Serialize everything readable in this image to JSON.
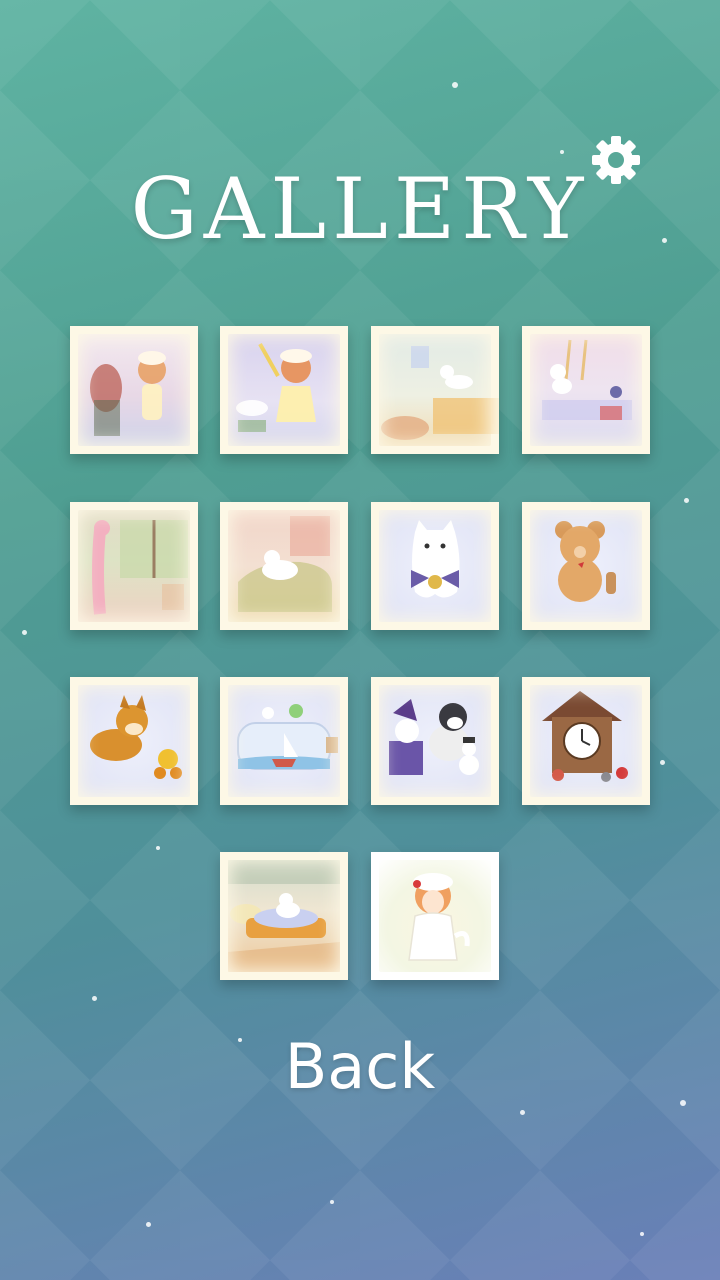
{
  "title": "GALLERY",
  "back_label": "Back",
  "settings_icon": "gear-icon",
  "gallery": [
    {
      "name": "gallery-item-1",
      "scene": "girl-with-mother"
    },
    {
      "name": "gallery-item-2",
      "scene": "girl-with-cat-toy"
    },
    {
      "name": "gallery-item-3",
      "scene": "cat-on-wall"
    },
    {
      "name": "gallery-item-4",
      "scene": "cats-on-ladder"
    },
    {
      "name": "gallery-item-5",
      "scene": "pink-cat-window"
    },
    {
      "name": "gallery-item-6",
      "scene": "cat-on-chair"
    },
    {
      "name": "gallery-item-7",
      "scene": "ghost-cat-bow"
    },
    {
      "name": "gallery-item-8",
      "scene": "teddy-bear"
    },
    {
      "name": "gallery-item-9",
      "scene": "shiba-dog-toy"
    },
    {
      "name": "gallery-item-10",
      "scene": "bottle-ship"
    },
    {
      "name": "gallery-item-11",
      "scene": "penguin-snowman"
    },
    {
      "name": "gallery-item-12",
      "scene": "cuckoo-clock"
    },
    {
      "name": "gallery-item-13",
      "scene": "cat-bed"
    },
    {
      "name": "gallery-item-14",
      "scene": "girl-in-white"
    }
  ]
}
